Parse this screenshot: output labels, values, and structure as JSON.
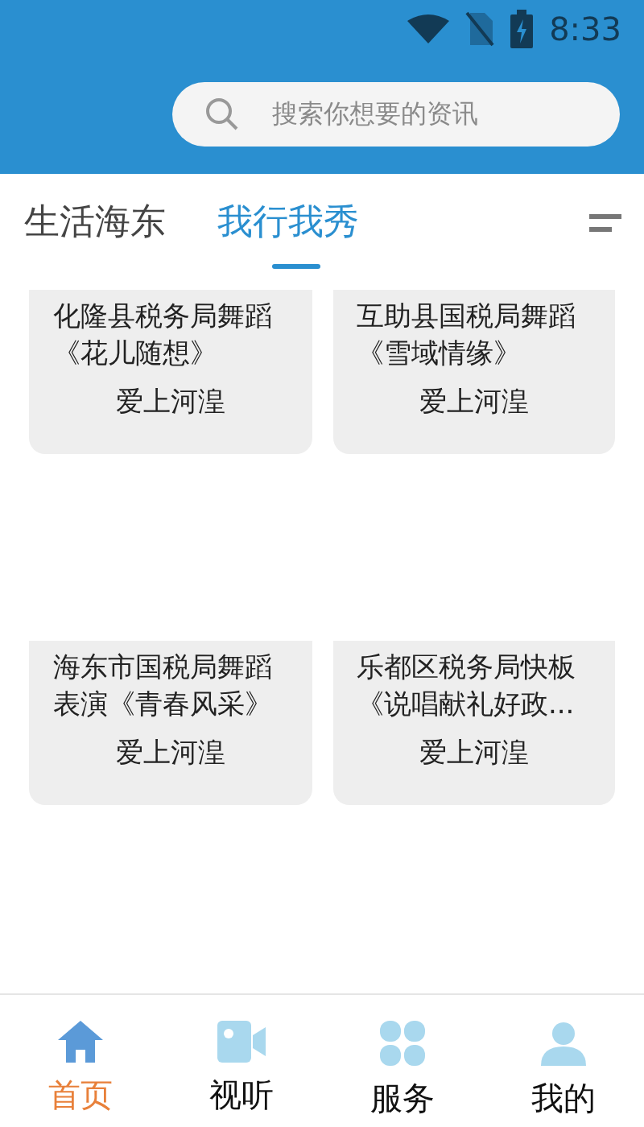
{
  "status_bar": {
    "time": "8:33"
  },
  "search": {
    "placeholder": "搜索你想要的资讯"
  },
  "tabs": [
    {
      "label": "生活海东",
      "selected": false
    },
    {
      "label": "我行我秀",
      "selected": true
    }
  ],
  "cards": [
    {
      "title": "化隆县税务局舞蹈《花儿随想》",
      "source": "爱上河湟"
    },
    {
      "title": "互助县国税局舞蹈《雪域情缘》",
      "source": "爱上河湟"
    },
    {
      "title": "海东市国税局舞蹈表演《青春风采》",
      "source": "爱上河湟"
    },
    {
      "title": "乐都区税务局快板《说唱献礼好政...",
      "source": "爱上河湟"
    }
  ],
  "bottom_nav": [
    {
      "label": "首页",
      "kind": "home",
      "selected": true
    },
    {
      "label": "视听",
      "kind": "video",
      "selected": false
    },
    {
      "label": "服务",
      "kind": "services",
      "selected": false
    },
    {
      "label": "我的",
      "kind": "profile",
      "selected": false
    }
  ]
}
